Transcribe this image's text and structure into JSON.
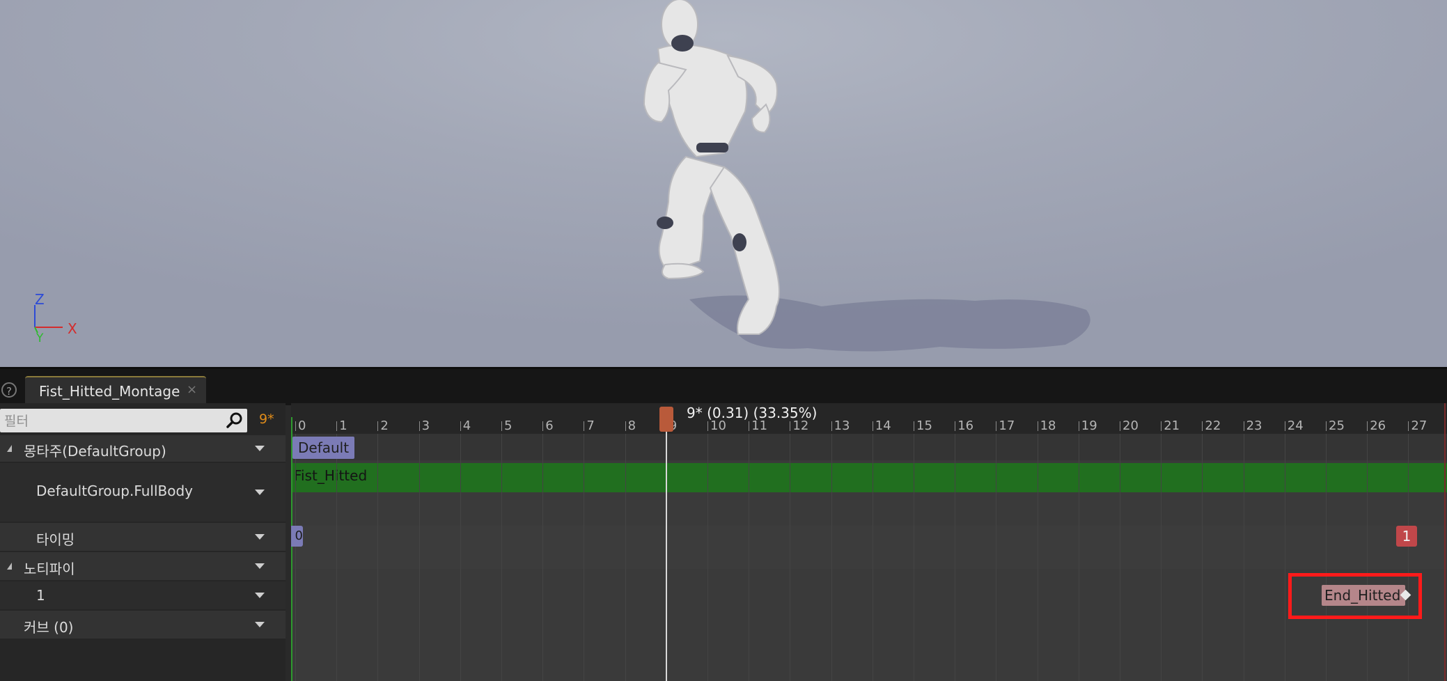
{
  "viewport": {
    "axis_labels": {
      "z": "Z",
      "x": "X",
      "y": "Y"
    },
    "axis_colors": {
      "z": "#2d4bd6",
      "x": "#d42c2c",
      "y": "#2dbb2d"
    }
  },
  "tabs": [
    {
      "label": "Fist_Hitted_Montage",
      "close_icon": "close-icon"
    }
  ],
  "left_panel": {
    "filter_placeholder": "필터",
    "frame_indicator": "9*",
    "rows": [
      {
        "label": "몽타주(DefaultGroup)",
        "expandable": true
      },
      {
        "label": "DefaultGroup.FullBody",
        "expandable": false
      },
      {
        "label": "타이밍",
        "expandable": false
      },
      {
        "label": "노티파이",
        "expandable": true
      },
      {
        "label": "1",
        "expandable": false
      },
      {
        "label": "커브   (0)",
        "expandable": false
      }
    ]
  },
  "timeline": {
    "ticks": [
      "0",
      "1",
      "2",
      "3",
      "4",
      "5",
      "6",
      "7",
      "8",
      "9",
      "10",
      "11",
      "12",
      "13",
      "14",
      "15",
      "16",
      "17",
      "18",
      "19",
      "20",
      "21",
      "22",
      "23",
      "24",
      "25",
      "26",
      "27"
    ],
    "playhead": {
      "frame": 9,
      "label": "9* (0.31) (33.35%)"
    },
    "section_label": "Default",
    "slot_label": "Fist_Hitted",
    "timing_start_label": "0",
    "timing_end_label": "1",
    "notify_label": "End_Hitted"
  },
  "colors": {
    "slot_green": "#216f1f",
    "section_purple": "#7b7bb6",
    "timing_red": "#c0474a",
    "notify_pink": "#b5868a",
    "highlight_red": "#ff1a1a",
    "frame_orange": "#e08c1a"
  }
}
